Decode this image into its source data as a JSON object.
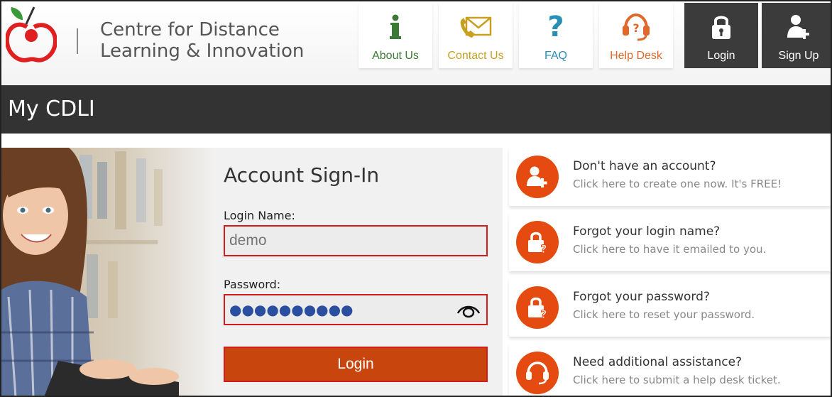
{
  "brand": {
    "name_line1": "Centre for Distance",
    "name_line2": "Learning & Innovation"
  },
  "nav": [
    {
      "label": "About Us",
      "icon": "info-icon",
      "color": "#3a7a35"
    },
    {
      "label": "Contact Us",
      "icon": "envelope-phone-icon",
      "color": "#c8a020"
    },
    {
      "label": "FAQ",
      "icon": "question-icon",
      "color": "#2a8fb5"
    },
    {
      "label": "Help Desk",
      "icon": "headset-icon",
      "color": "#e0682a"
    },
    {
      "label": "Login",
      "icon": "lock-icon",
      "color": "#ffffff"
    },
    {
      "label": "Sign Up",
      "icon": "user-add-icon",
      "color": "#ffffff"
    }
  ],
  "page": {
    "title": "My CDLI"
  },
  "signin": {
    "title": "Account Sign-In",
    "login_name_label": "Login Name:",
    "login_name_placeholder": "demo",
    "password_label": "Password:",
    "password_value": "●●●●●●●●●●",
    "login_button": "Login"
  },
  "cards": [
    {
      "title": "Don't have an account?",
      "subtitle": "Click here to create one now. It's FREE!",
      "icon": "user-add-icon"
    },
    {
      "title": "Forgot your login name?",
      "subtitle": "Click here to have it emailed to you.",
      "icon": "lock-question-icon"
    },
    {
      "title": "Forgot your password?",
      "subtitle": "Click here to reset your password.",
      "icon": "lock-question-icon"
    },
    {
      "title": "Need additional assistance?",
      "subtitle": "Click here to submit a help desk ticket.",
      "icon": "headset-icon"
    }
  ],
  "colors": {
    "accent": "#e54b10",
    "login_button": "#c9450e",
    "field_border": "#d21b1b",
    "titlebar": "#333333",
    "dark_tile": "#3b3b3b"
  }
}
